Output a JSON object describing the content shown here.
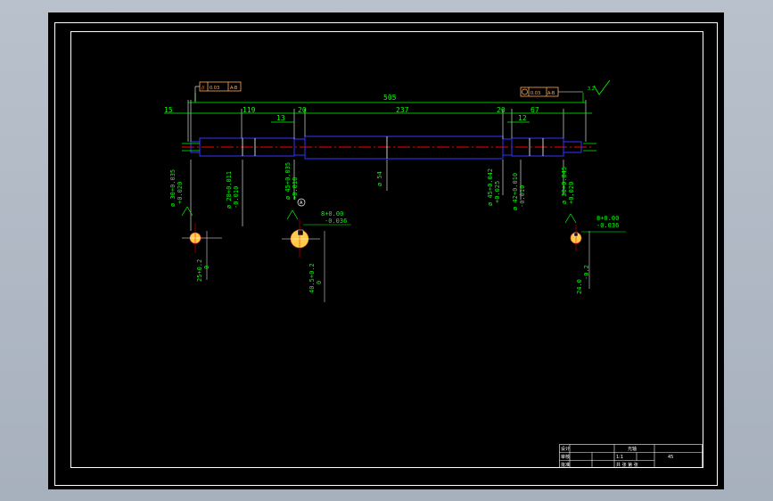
{
  "colors": {
    "background": "#a7b0bd",
    "sheet": "#000000",
    "frame": "#ffffff",
    "dimension": "#00ff00",
    "outline": "#3333ff",
    "centerline": "#ff0000",
    "tolerance_box": "#ffaa55",
    "section_hatch": "#ffcc44"
  },
  "drawing": {
    "overall_length": "505",
    "left_end": "15",
    "seg_119": "119",
    "seg_13": "13",
    "seg_20_left": "20",
    "seg_237": "237",
    "seg_20_right": "20",
    "seg_67": "67",
    "seg_12": "12",
    "dia_54": "ø 54",
    "tol_left_fits": [
      "ø 30+0.035",
      "+0.020",
      "ø 28+0.011",
      "-0.010"
    ],
    "tol_mid_fits": [
      "ø 45+0.035",
      "+0.018"
    ],
    "tol_right_fits": [
      "ø 45+0.042",
      "+0.025",
      "ø 42+0.010",
      "-0.010"
    ],
    "tol_far_right": [
      "ø 30+0.045",
      "+0.020"
    ],
    "section_left_depth": "25+0.2",
    "section_left_depth_lower": "0",
    "section_mid_width": "8+0.00",
    "section_mid_width_lower": "-0.036",
    "section_mid_depth": "40.5+0.2",
    "section_mid_depth_lower": "0",
    "section_right_width": "8+0.00",
    "section_right_width_lower": "-0.036",
    "section_right_depth": "24.0",
    "section_right_depth_lower": "-0.2",
    "gtol_left": "0.03",
    "gtol_left_ref": "A-B",
    "gtol_right": "0.03",
    "gtol_right_ref": "A-B",
    "roughness": "3.2",
    "datum_mid": "A"
  },
  "title_block": {
    "part_name": "光轴",
    "material": "45",
    "scale": "1:1",
    "drawn": "设计",
    "checked": "审核",
    "approved": "批准",
    "sheet": "共 张 第 张"
  }
}
